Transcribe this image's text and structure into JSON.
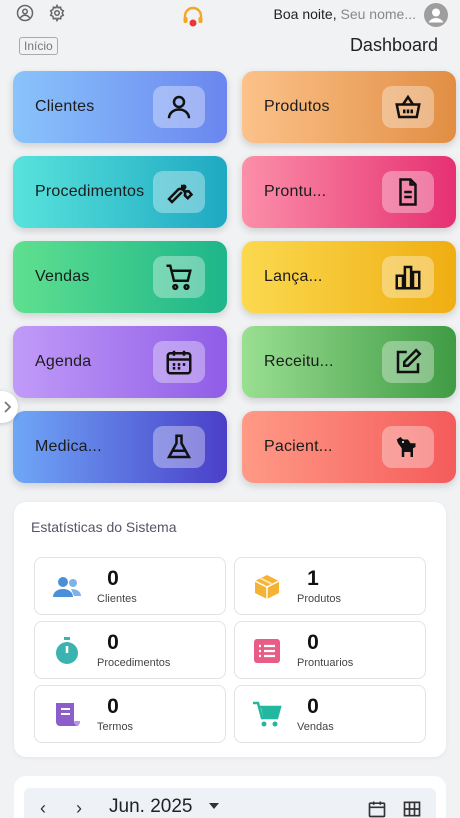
{
  "header": {
    "greeting": "Boa noite,",
    "user_placeholder": "Seu nome...",
    "icons": [
      "user-circle-icon",
      "gear-icon",
      "headset-logo",
      "avatar-icon"
    ]
  },
  "breadcrumb": {
    "label": "Início"
  },
  "page_title": "Dashboard",
  "menu": [
    {
      "label": "Clientes",
      "icon": "user-icon"
    },
    {
      "label": "Produtos",
      "icon": "basket-icon"
    },
    {
      "label": "Procedimentos",
      "icon": "wrench-icon"
    },
    {
      "label": "Prontu...",
      "icon": "document-icon"
    },
    {
      "label": "Vendas",
      "icon": "cart-icon"
    },
    {
      "label": "Lança...",
      "icon": "bar-chart-icon"
    },
    {
      "label": "Agenda",
      "icon": "calendar-icon"
    },
    {
      "label": "Receitu...",
      "icon": "edit-icon"
    },
    {
      "label": "Medica...",
      "icon": "flask-icon"
    },
    {
      "label": "Pacient...",
      "icon": "dog-icon"
    }
  ],
  "stats": {
    "title": "Estatísticas do Sistema",
    "items": [
      {
        "value": "0",
        "label": "Clientes",
        "icon": "users-icon",
        "color": "#4a90d9"
      },
      {
        "value": "1",
        "label": "Produtos",
        "icon": "box-icon",
        "color": "#f5b335"
      },
      {
        "value": "0",
        "label": "Procedimentos",
        "icon": "stopwatch-icon",
        "color": "#3bb3b0"
      },
      {
        "value": "0",
        "label": "Prontuarios",
        "icon": "list-icon",
        "color": "#e95c86"
      },
      {
        "value": "0",
        "label": "Termos",
        "icon": "scroll-icon",
        "color": "#8c5ec9"
      },
      {
        "value": "0",
        "label": "Vendas",
        "icon": "cart-icon",
        "color": "#22b8a0"
      }
    ]
  },
  "calendar": {
    "prev": "‹",
    "next": "›",
    "month": "Jun. 2025"
  }
}
